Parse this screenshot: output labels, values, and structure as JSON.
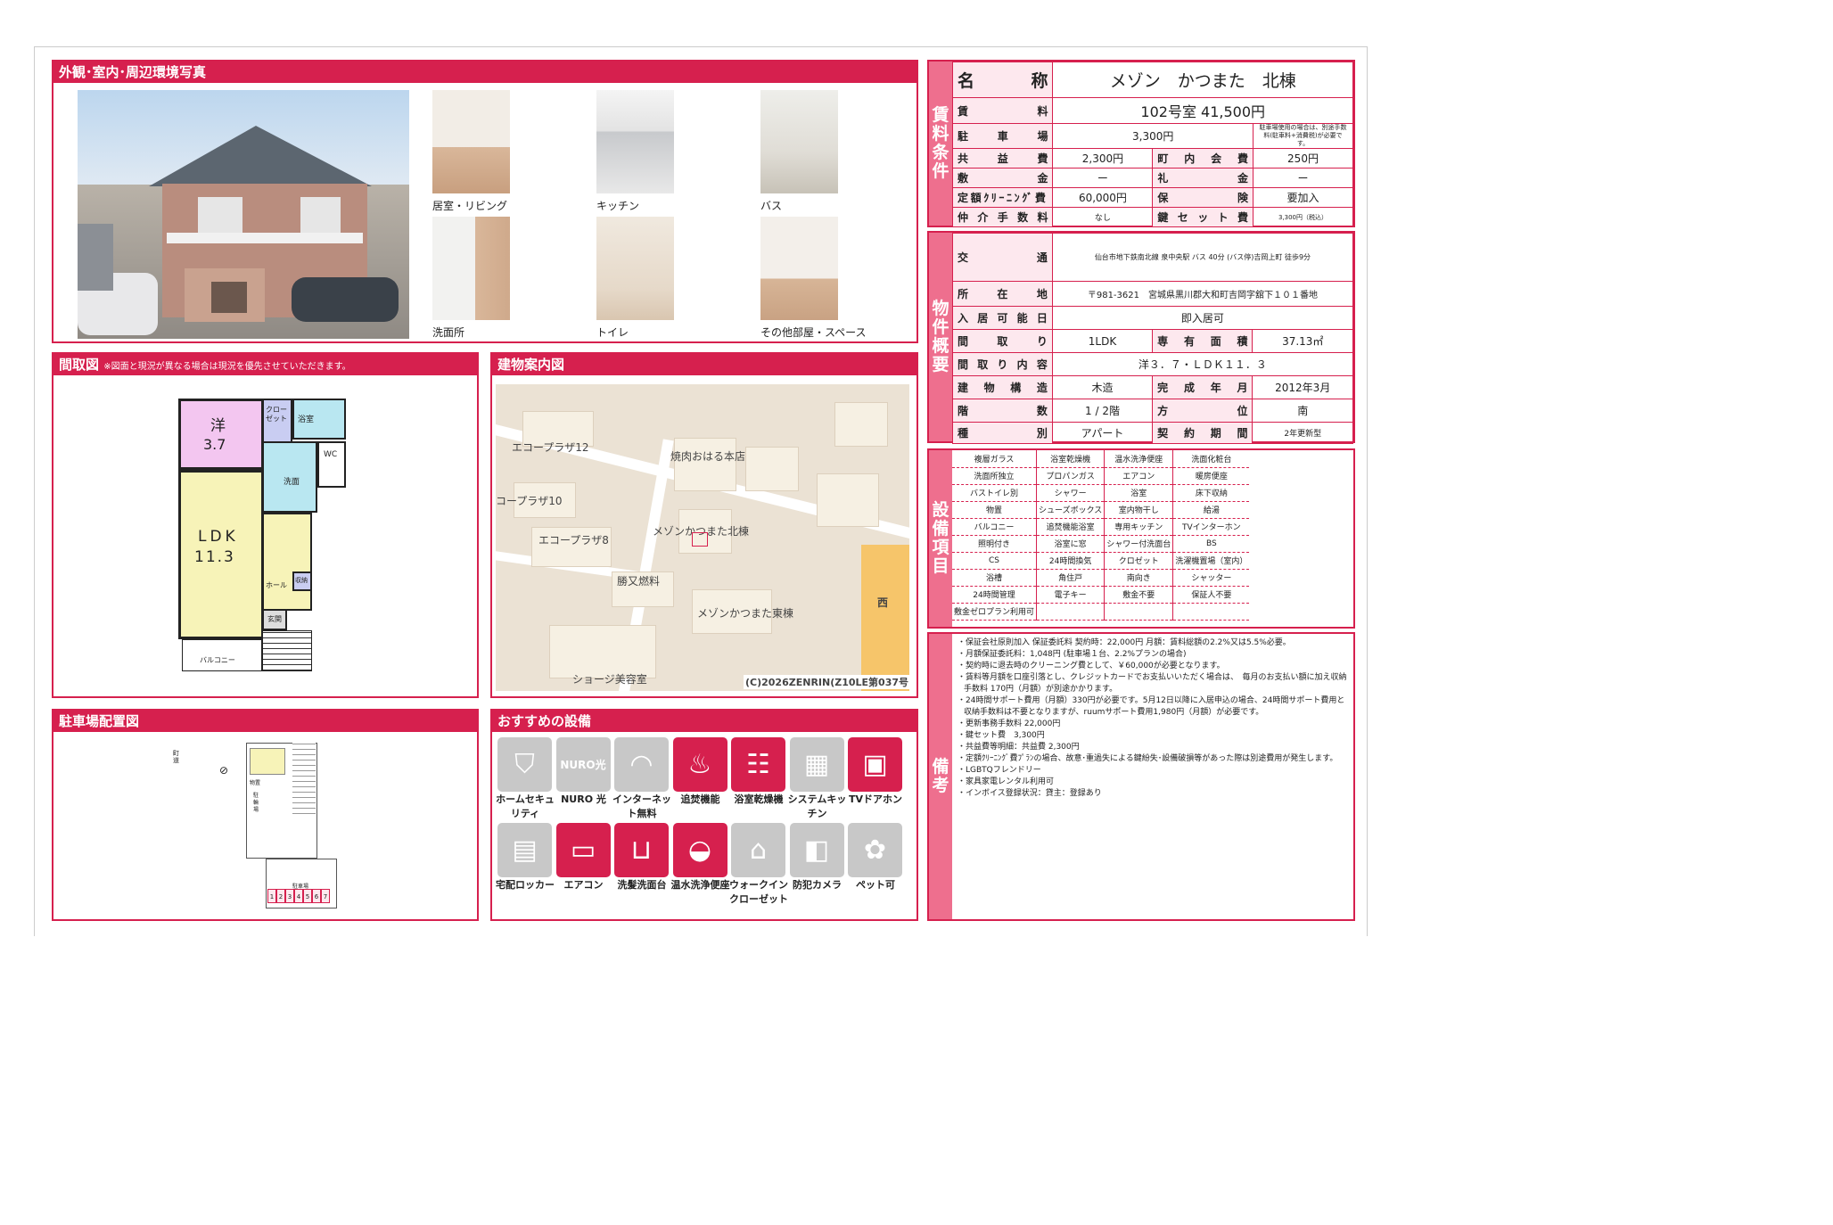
{
  "photos": {
    "header": "外観･室内･周辺環境写真",
    "items": [
      {
        "name": "photo-living",
        "caption": "居室・リビング"
      },
      {
        "name": "photo-kitchen",
        "caption": "キッチン"
      },
      {
        "name": "photo-bath",
        "caption": "バス"
      },
      {
        "name": "photo-washroom",
        "caption": "洗面所"
      },
      {
        "name": "photo-toilet",
        "caption": "トイレ"
      },
      {
        "name": "photo-other-room",
        "caption": "その他部屋・スペース"
      }
    ]
  },
  "floorplan": {
    "header": "間取図",
    "note": "※図面と現況が異なる場合は現況を優先させていただきます。",
    "labels": {
      "yo": "洋",
      "yo_size": "3.7",
      "closet": "クロー ゼット",
      "bath": "浴室",
      "wc": "WC",
      "wash": "洗面",
      "ldk": "LDK",
      "ldk_size": "11.3",
      "hall": "ホール",
      "storage": "収納",
      "entrance": "玄関",
      "balcony": "バルコニー"
    }
  },
  "building_map": {
    "header": "建物案内図",
    "labels": [
      "エコープラザ12",
      "焼肉おはる本店",
      "コープラザ10",
      "エコープラザ8",
      "メゾンかつまた北棟",
      "勝又燃料",
      "メゾンかつまた東棟",
      "ショージ美容室",
      "西"
    ],
    "copyright": "(C)2026ZENRIN(Z10LE第037号)"
  },
  "parking": {
    "header": "駐車場配置図",
    "road": "町道",
    "bicycle": "駐輪場",
    "waste": "物置",
    "lot": "駐車場",
    "numbers": [
      "1",
      "2",
      "3",
      "4",
      "5",
      "6",
      "7"
    ]
  },
  "recommended": {
    "header": "おすすめの設備",
    "items": [
      {
        "label": "ホームセキュリティ",
        "on": false,
        "icon": "shield-icon",
        "glyph": "⛉"
      },
      {
        "label": "NURO 光",
        "on": false,
        "icon": "nuro-icon",
        "glyph": "NURO光"
      },
      {
        "label": "インターネット無料",
        "on": false,
        "icon": "wifi-icon",
        "glyph": "◠"
      },
      {
        "label": "追焚機能",
        "on": true,
        "icon": "bathtub-icon",
        "glyph": "♨"
      },
      {
        "label": "浴室乾燥機",
        "on": true,
        "icon": "bath-dryer-icon",
        "glyph": "☷"
      },
      {
        "label": "システムキッチン",
        "on": false,
        "icon": "kitchen-icon",
        "glyph": "▦"
      },
      {
        "label": "TVドアホン",
        "on": true,
        "icon": "intercom-icon",
        "glyph": "▣"
      },
      {
        "label": "宅配ロッカー",
        "on": false,
        "icon": "locker-icon",
        "glyph": "▤"
      },
      {
        "label": "エアコン",
        "on": true,
        "icon": "aircon-icon",
        "glyph": "▭"
      },
      {
        "label": "洗髪洗面台",
        "on": true,
        "icon": "washbasin-icon",
        "glyph": "⊔"
      },
      {
        "label": "温水洗浄便座",
        "on": true,
        "icon": "toilet-icon",
        "glyph": "◒"
      },
      {
        "label": "ウォークインクローゼット",
        "on": false,
        "icon": "closet-icon",
        "glyph": "⌂"
      },
      {
        "label": "防犯カメラ",
        "on": false,
        "icon": "camera-icon",
        "glyph": "◧"
      },
      {
        "label": "ペット可",
        "on": false,
        "icon": "paw-icon",
        "glyph": "✿"
      }
    ]
  },
  "rent": {
    "label": "賃料条件",
    "name_key": "名　称",
    "name": "メゾン　かつまた　北棟",
    "rent_key": "賃　料",
    "rent": "102号室 41,500円",
    "parking_key": "駐　車　場",
    "parking": "3,300円",
    "parking_note": "駐車場使用の場合は、別途手数料(駐車料+消費税)が必要です。",
    "common_key": "共　益　費",
    "common": "2,300円",
    "town_key": "町　内　会　費",
    "town": "250円",
    "deposit_key": "敷　金",
    "deposit": "ー",
    "key_money_key": "礼　金",
    "key_money": "ー",
    "cleaning_key": "定額ｸﾘｰﾆﾝｸﾞ費",
    "cleaning": "60,000円",
    "insurance_key": "保　険",
    "insurance": "要加入",
    "brokerage_key": "仲介手数料",
    "brokerage": "なし",
    "lock_key": "鍵セット費",
    "lock": "3,300円（税込）"
  },
  "property": {
    "label": "物件概要",
    "access_key": "交　通",
    "access": "仙台市地下鉄南北線 泉中央駅 バス 40分 (バス停)吉岡上町 徒歩9分",
    "address_key": "所　在　地",
    "address": "〒981-3621　宮城県黒川郡大和町吉岡字舘下１０１番地",
    "movein_key": "入居可能日",
    "movein": "即入居可",
    "layout_key": "間　取　り",
    "layout": "1LDK",
    "area_key": "専有面積",
    "area": "37.13㎡",
    "layout_detail_key": "間取り内容",
    "layout_detail": "洋３．７・ＬＤＫ１１．３",
    "structure_key": "建物構造",
    "structure": "木造",
    "built_key": "完成年月",
    "built": "2012年3月",
    "floor_key": "階　数",
    "floor": "1 / 2階",
    "direction_key": "方　位",
    "direction": "南",
    "type_key": "種　別",
    "type": "アパート",
    "contract_key": "契約期間",
    "contract": "2年更新型"
  },
  "equipment": {
    "label": "設備項目",
    "rows": [
      [
        "複層ガラス",
        "浴室乾燥機",
        "温水洗浄便座",
        "洗面化粧台"
      ],
      [
        "洗面所独立",
        "プロパンガス",
        "エアコン",
        "暖房便座"
      ],
      [
        "バストイレ別",
        "シャワー",
        "浴室",
        "床下収納"
      ],
      [
        "物置",
        "シューズボックス",
        "室内物干し",
        "給湯"
      ],
      [
        "バルコニー",
        "追焚機能浴室",
        "専用キッチン",
        "TVインターホン"
      ],
      [
        "照明付き",
        "浴室に窓",
        "シャワー付洗面台",
        "BS"
      ],
      [
        "CS",
        "24時間換気",
        "クロゼット",
        "洗濯機置場（室内）"
      ],
      [
        "浴槽",
        "角住戸",
        "南向き",
        "シャッター"
      ],
      [
        "24時間管理",
        "電子キー",
        "敷金不要",
        "保証人不要"
      ],
      [
        "敷金ゼロプラン利用可",
        "",
        "",
        ""
      ]
    ]
  },
  "remarks": {
    "label": "備考",
    "lines": [
      "・保証会社原則加入 保証委託料 契約時：22,000円 月額：賃料総額の2.2%又は5.5%必要。",
      "・月額保証委託料：1,048円 (駐車場１台、2.2%プランの場合)",
      "・契約時に退去時のクリーニング費として、￥60,000が必要となります。",
      "・賃料等月額を口座引落とし、クレジットカードでお支払いいただく場合は、　毎月のお支払い額に加え収納手数料 170円（月額）が別途かかります。",
      "・24時間サポート費用（月額）330円が必要です。5月12日以降に入居申込の場合、24時間サポート費用と収納手数料は不要となりますが、ruumサポート費用1,980円（月額）が必要です。",
      "・更新事務手数料 22,000円",
      "・鍵セット費　3,300円",
      "・共益費等明細：共益費 2,300円",
      "・定額ｸﾘｰﾆﾝｸﾞ費ﾌﾟﾗﾝの場合、故意･重過失による鍵紛失･設備破損等があった際は別途費用が発生します。",
      "・LGBTQフレンドリー",
      "・家具家電レンタル利用可",
      "・インボイス登録状況：貸主：登録あり"
    ]
  }
}
